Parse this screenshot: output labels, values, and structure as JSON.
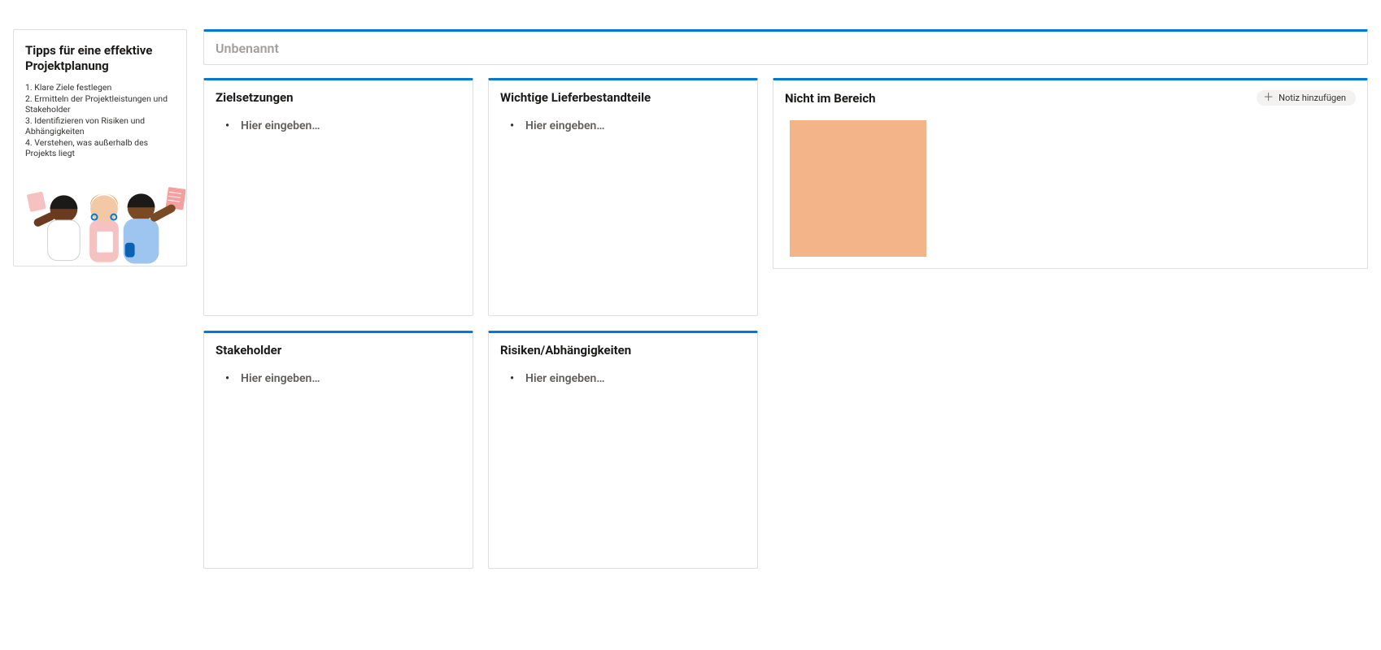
{
  "colors": {
    "accent": "#0078d4",
    "sticky": "#f4b48a"
  },
  "tips": {
    "title": "Tipps für eine effektive Projektplanung",
    "items": [
      "Klare Ziele festlegen",
      "Ermitteln der Projektleistungen und Stakeholder",
      "Identifizieren von Risiken und Abhängigkeiten",
      "Verstehen, was außerhalb des Projekts liegt"
    ]
  },
  "titleCard": {
    "placeholder": "Unbenannt"
  },
  "sections": {
    "goals": {
      "title": "Zielsetzungen",
      "placeholder": "Hier eingeben…"
    },
    "deliverables": {
      "title": "Wichtige Lieferbestandteile",
      "placeholder": "Hier eingeben…"
    },
    "stakeholders": {
      "title": "Stakeholder",
      "placeholder": "Hier eingeben…"
    },
    "risks": {
      "title": "Risiken/Abhängigkeiten",
      "placeholder": "Hier eingeben…"
    },
    "outOfScope": {
      "title": "Nicht im Bereich",
      "addNoteLabel": "Notiz hinzufügen"
    }
  }
}
